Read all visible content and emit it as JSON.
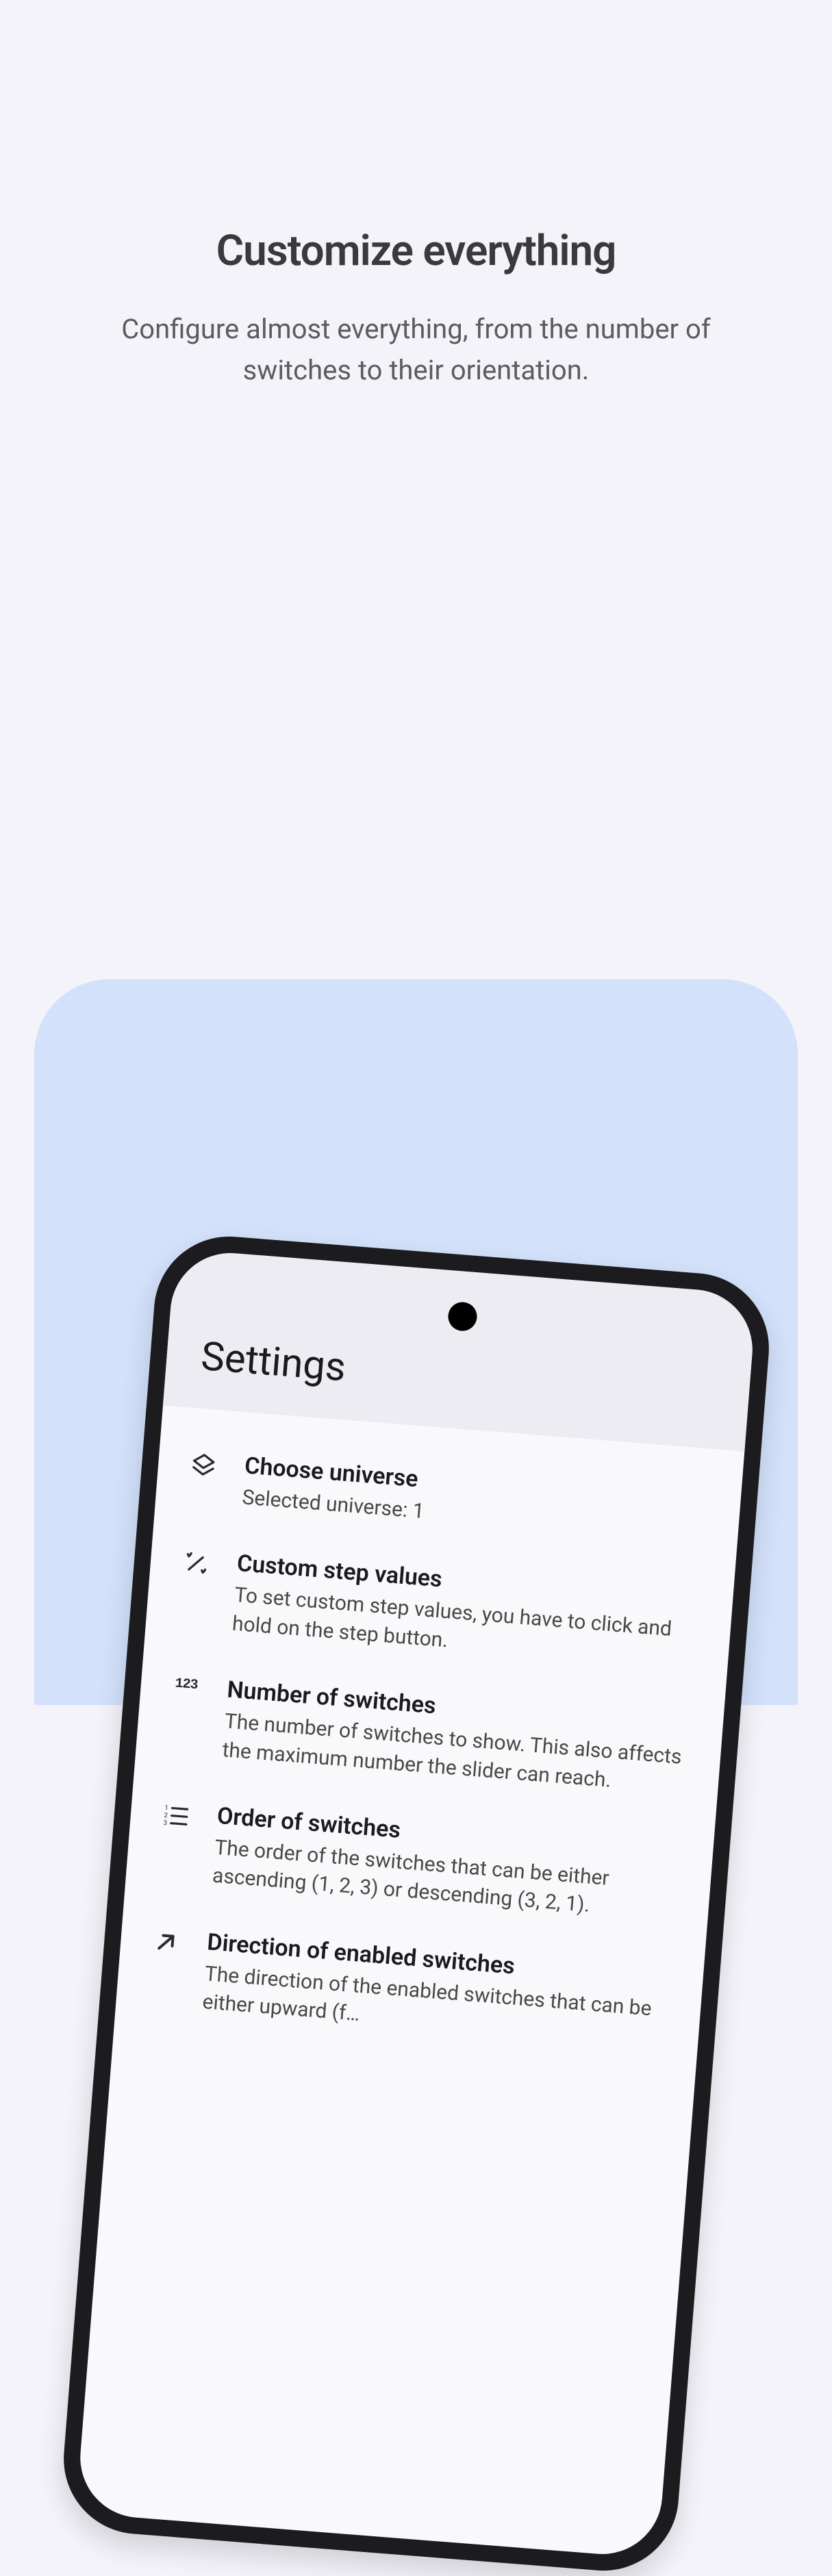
{
  "promo": {
    "title": "Customize everything",
    "subtitle": "Configure almost everything, from the number of switches to their orientation."
  },
  "screen": {
    "title": "Settings",
    "items": [
      {
        "title": "Choose universe",
        "desc": "Selected universe: 1",
        "icon": "layers-icon"
      },
      {
        "title": "Custom step values",
        "desc": "To set custom step values, you have to click and hold on the step button.",
        "icon": "wand-icon"
      },
      {
        "title": "Number of switches",
        "desc": "The number of switches to show. This also affects the maximum number the slider can reach.",
        "icon": "num123-icon"
      },
      {
        "title": "Order of switches",
        "desc": "The order of the switches that can be either ascending (1, 2, 3) or descending (3, 2, 1).",
        "icon": "ordered-list-icon"
      },
      {
        "title": "Direction of enabled switches",
        "desc": "The direction of the enabled switches that can be either upward (f…",
        "icon": "arrow-upright-icon"
      }
    ]
  }
}
